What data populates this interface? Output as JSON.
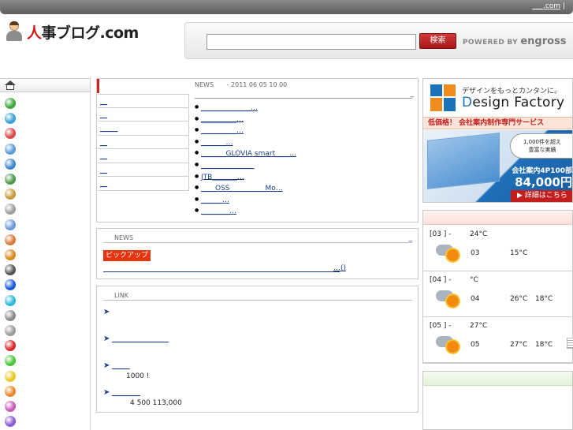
{
  "topbar": {
    "link": "___.com",
    "separator": "|"
  },
  "logo": {
    "red_char": "人",
    "text": "事ブログ.com"
  },
  "search": {
    "placeholder": "",
    "value": "",
    "button_label": "検索",
    "powered_label": "POWERED BY",
    "powered_brand": "engross"
  },
  "sidebar": {
    "icons": [
      {
        "name": "green-globe-icon",
        "color": "#3aa83a"
      },
      {
        "name": "atom-icon",
        "color": "#3aa0d8"
      },
      {
        "name": "abc-heart-icon",
        "color": "#d84a4a"
      },
      {
        "name": "fish-icon",
        "color": "#5a9ad8"
      },
      {
        "name": "gear-icon",
        "color": "#3a88c8"
      },
      {
        "name": "recycle-icon",
        "color": "#4a9a4a"
      },
      {
        "name": "people-icon",
        "color": "#c89a3a"
      },
      {
        "name": "syringe-icon",
        "color": "#a0a0a0"
      },
      {
        "name": "person-icon",
        "color": "#6a9ad8"
      },
      {
        "name": "pencil-icon",
        "color": "#d87a3a"
      },
      {
        "name": "books-icon",
        "color": "#d88a1a"
      },
      {
        "name": "calculator-icon",
        "color": "#555555"
      },
      {
        "name": "blue-ball-icon",
        "color": "#1a5ad8"
      },
      {
        "name": "cyan-ball-icon",
        "color": "#2ab8d8"
      },
      {
        "name": "gray-ball-icon",
        "color": "#8a8a8a"
      },
      {
        "name": "gray-ball-2-icon",
        "color": "#9a9a9a"
      },
      {
        "name": "red-ball-icon",
        "color": "#d82a2a"
      },
      {
        "name": "green-ball-icon",
        "color": "#4ac83a"
      },
      {
        "name": "yellow-ball-icon",
        "color": "#e8c82a"
      },
      {
        "name": "orange-ball-icon",
        "color": "#e8882a"
      },
      {
        "name": "pink-ball-icon",
        "color": "#c85ab8"
      },
      {
        "name": "purple-ball-icon",
        "color": "#8a5ad8"
      }
    ]
  },
  "news": {
    "label": "NEWS",
    "date": "- 2011 06 05  10 00",
    "headline_tail": "_",
    "tabs": [
      "__",
      "__",
      "_____",
      "__",
      "__",
      "__",
      "__"
    ],
    "items": [
      "______________…",
      "__________…",
      "__________…",
      "_______…",
      "_______GLOVIA smart____…",
      "_______________",
      "JTB_______…",
      "____OSS__________Mo…",
      "______…",
      "________…"
    ]
  },
  "pickup": {
    "label": "NEWS",
    "tail": "_",
    "badge": "ピックアップ",
    "link_tail": "…()"
  },
  "links": {
    "label": "LINK",
    "rows": [
      {
        "text": "",
        "sub": ""
      },
      {
        "text": "________________",
        "sub": ""
      },
      {
        "text": "_____",
        "sub": "1000  !"
      },
      {
        "text": "________",
        "sub": "4  500 113,000"
      }
    ]
  },
  "ad": {
    "tagline": "デザインをもっとカンタンに。",
    "brand_initial": "D",
    "brand_rest": "esign Factory",
    "strip": "低価格！  会社案内制作専門サービス",
    "bubble_line1": "1,000件を超え",
    "bubble_line2": "豊富な実績",
    "price_label": "会社案内4P100部",
    "price": "84,000円",
    "detail": "▶ 詳細はこちら"
  },
  "weather": [
    {
      "date": "[03    ] -",
      "temp_top": "24°C",
      "day": "03",
      "hi": "15°C",
      "lo": ""
    },
    {
      "date": "[04    ] -",
      "temp_top": "°C",
      "day": "04",
      "hi": "26°C",
      "lo": "18°C"
    },
    {
      "date": "[05    ] -",
      "temp_top": "27°C",
      "day": "05",
      "hi": "27°C",
      "lo": "18°C"
    }
  ]
}
